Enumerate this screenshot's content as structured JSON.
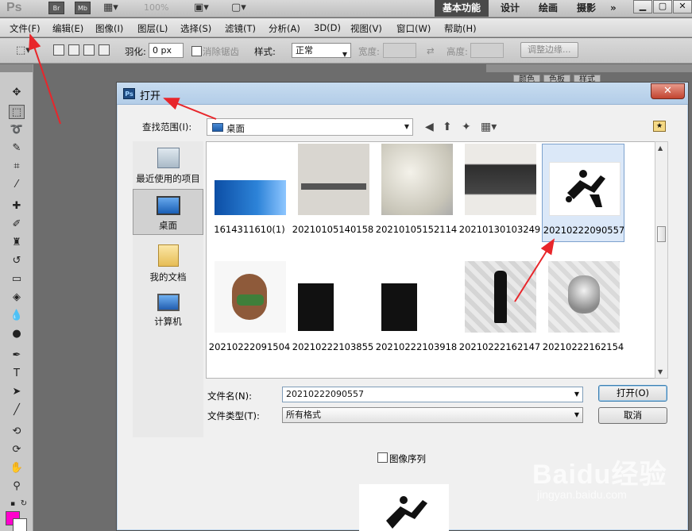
{
  "app": {
    "logo": "Ps",
    "launch": {
      "bridge": "Br",
      "mini_bridge": "Mb"
    },
    "zoom": "100%",
    "workspaces": [
      "基本功能",
      "设计",
      "绘画",
      "摄影"
    ],
    "overflow": "»"
  },
  "menu": [
    "文件(F)",
    "编辑(E)",
    "图像(I)",
    "图层(L)",
    "选择(S)",
    "滤镜(T)",
    "分析(A)",
    "3D(D)",
    "视图(V)",
    "窗口(W)",
    "帮助(H)"
  ],
  "options": {
    "feather_label": "羽化:",
    "feather_value": "0 px",
    "antialias_label": "消除锯齿",
    "style_label": "样式:",
    "style_value": "正常",
    "width_label": "宽度:",
    "height_label": "高度:",
    "refine_edge": "调整边缘..."
  },
  "panels": {
    "tabs": [
      "颜色",
      "色板",
      "样式"
    ]
  },
  "dialog": {
    "title": "打开",
    "look_in_label": "查找范围(I):",
    "look_in_value": "桌面",
    "places": [
      {
        "label": "最近使用的项目",
        "icon": "recent-items-icon"
      },
      {
        "label": "桌面",
        "icon": "desktop-icon"
      },
      {
        "label": "我的文档",
        "icon": "my-documents-icon"
      },
      {
        "label": "计算机",
        "icon": "computer-icon"
      }
    ],
    "files": [
      "1614311610(1)",
      "20210105140158",
      "20210105152114",
      "20210130103249",
      "20210222090557",
      "20210222091504",
      "20210222103855",
      "20210222103918",
      "20210222162147",
      "20210222162154"
    ],
    "selected_file": "20210222090557",
    "file_name_label": "文件名(N):",
    "file_name_value": "20210222090557",
    "file_type_label": "文件类型(T):",
    "file_type_value": "所有格式",
    "open_button": "打开(O)",
    "cancel_button": "取消",
    "image_sequence_label": "图像序列",
    "close_glyph": "✕"
  },
  "watermark": {
    "brand": "Baidu经验",
    "url": "jingyan.baidu.com"
  },
  "colors": {
    "foreground": "#ff00cc",
    "annotation": "#e8262b",
    "selection": "#dbe8f8"
  }
}
